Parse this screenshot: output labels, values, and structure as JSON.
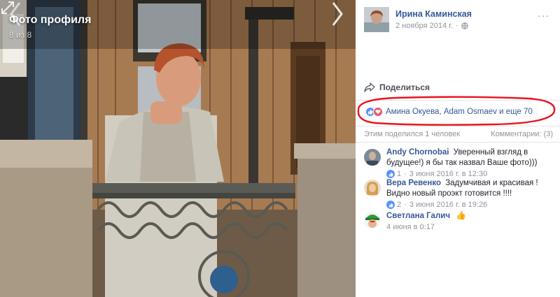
{
  "photo": {
    "title": "Фото профиля",
    "counter": "8 из 8"
  },
  "post": {
    "author": "Ирина Каминская",
    "date": "2 ноября 2014 г.",
    "date_separator": "·",
    "more": "···",
    "share_label": "Поделиться",
    "reactions_text": "Амина Окуева, Adam Osmaev и еще 70",
    "shares_text": "Этим поделился 1 человек",
    "comments_text": "Комментарии: (3)"
  },
  "comments": [
    {
      "author": "Andy Chornobai",
      "text": "Уверенный взгляд в будущее!) я бы так назвал Ваше фото)))",
      "likes": "1",
      "time": "3 июня 2016 г. в 12:30"
    },
    {
      "author": "Вера Ревенко",
      "text": "Задумчивая и красивая ! Видно новый проэкт готовится !!!!",
      "likes": "2",
      "time": "3 июня 2016 г. в 19:26"
    },
    {
      "author": "Светлана Галич",
      "text": "",
      "time": "4 июня в 0:17"
    }
  ],
  "colors": {
    "link_blue": "#365899",
    "like_blue": "#5890ff",
    "love_red": "#f25268",
    "annotation_red": "#e8141e",
    "muted": "#90949c"
  },
  "icons": [
    "expand-icon",
    "prev-arrow-icon",
    "next-arrow-icon",
    "globe-icon",
    "share-icon",
    "like-icon",
    "love-icon",
    "thumbs-up-emoji"
  ]
}
